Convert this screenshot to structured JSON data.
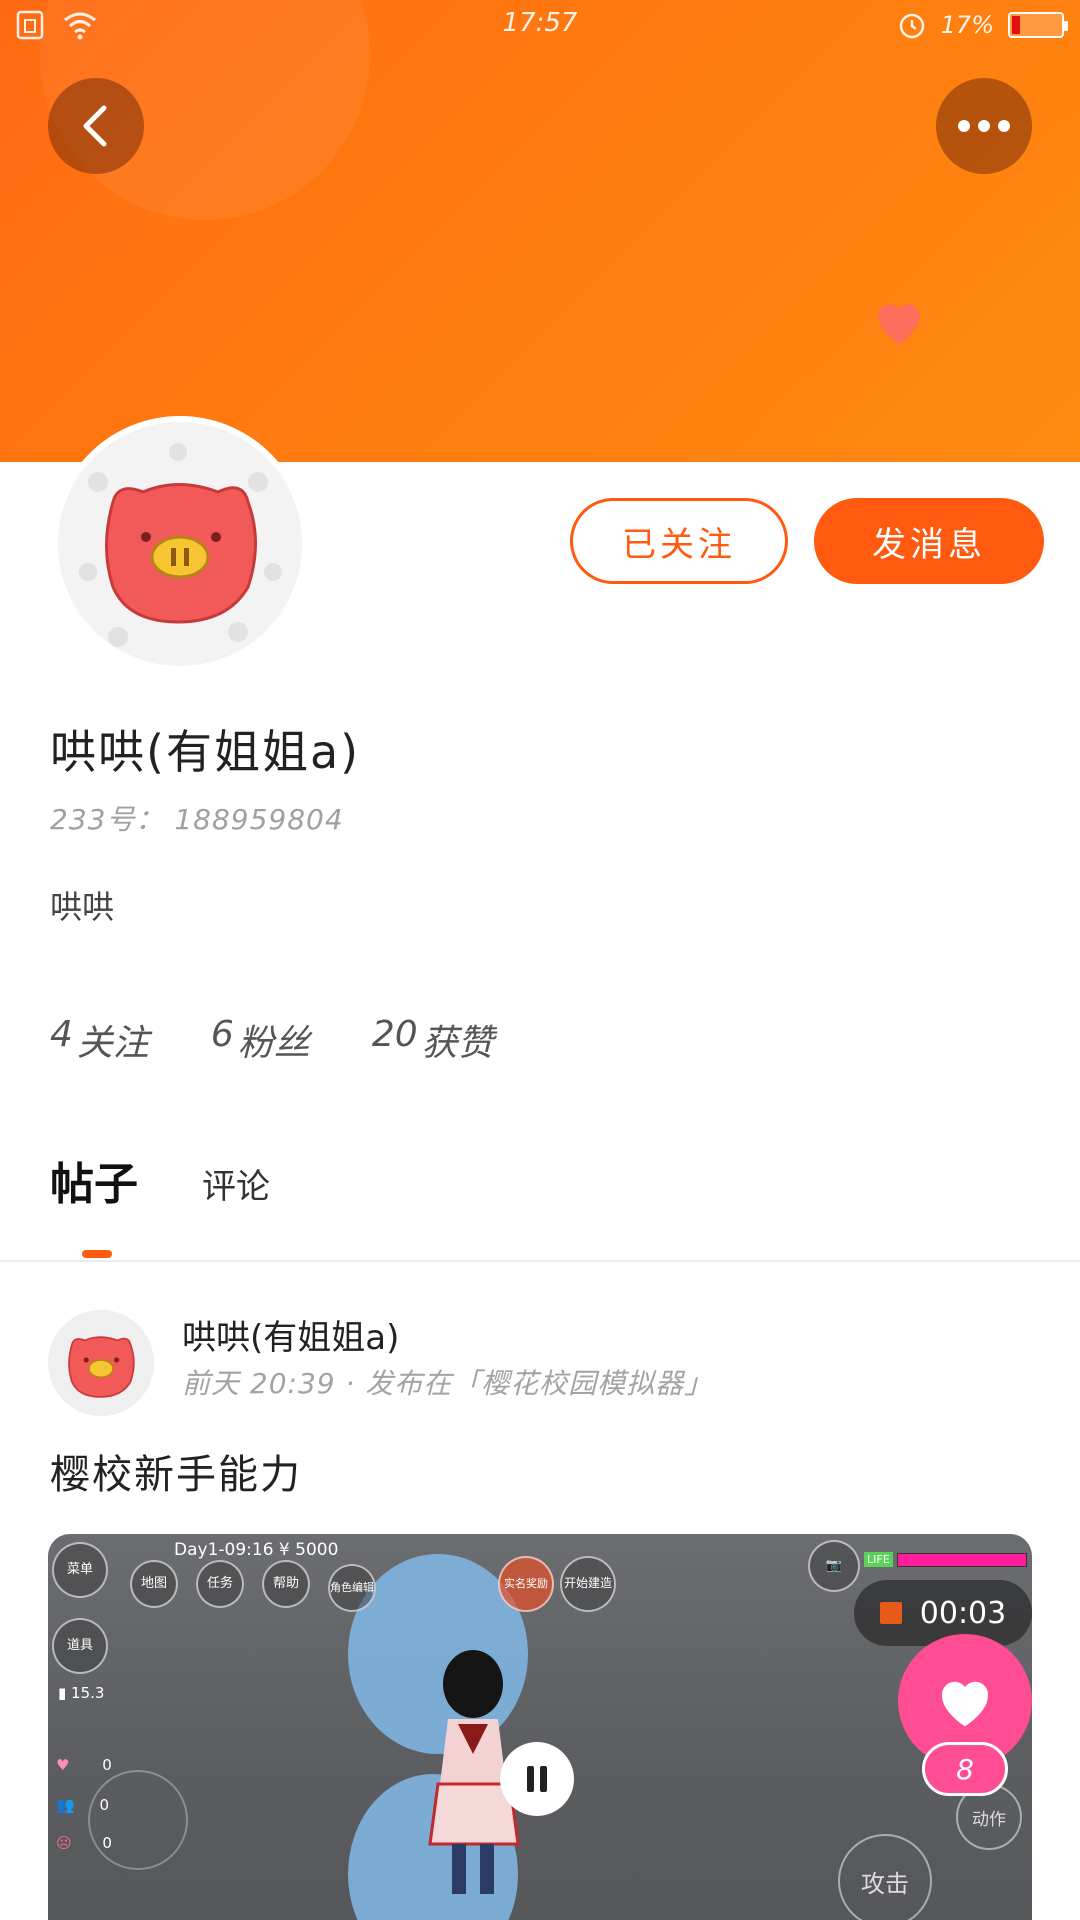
{
  "status_bar": {
    "time": "17:57",
    "battery_percent": "17%"
  },
  "header": {
    "back_label": "back",
    "more_label": "more"
  },
  "profile": {
    "follow_button": "已关注",
    "message_button": "发消息",
    "username": "哄哄(有姐姐a)",
    "id_label": "233号：",
    "id_value": "188959804",
    "bio": "哄哄",
    "stats": {
      "following_count": "4",
      "following_label": "关注",
      "fans_count": "6",
      "fans_label": "粉丝",
      "likes_count": "20",
      "likes_label": "获赞"
    }
  },
  "tabs": {
    "posts": "帖子",
    "comments": "评论"
  },
  "post": {
    "author": "哄哄(有姐姐a)",
    "meta": "前天 20:39 · 发布在「樱花校园模拟器」",
    "title": "樱校新手能力",
    "video": {
      "game_status": "Day1-09:16 ¥ 5000",
      "rec_time": "00:03",
      "buttons": {
        "menu": "菜单",
        "map": "地图",
        "task": "任务",
        "help": "帮助",
        "role": "角色编辑",
        "build": "开始建造",
        "items": "道具",
        "reward": "实名奖励"
      },
      "attack": "攻击",
      "action": "动作",
      "money": "15.3",
      "heart": "0",
      "people": "0",
      "angry": "0"
    },
    "like_count": "8"
  },
  "colors": {
    "accent": "#ff5a0f",
    "banner": "#ff7a10",
    "like": "#ff4d94"
  }
}
